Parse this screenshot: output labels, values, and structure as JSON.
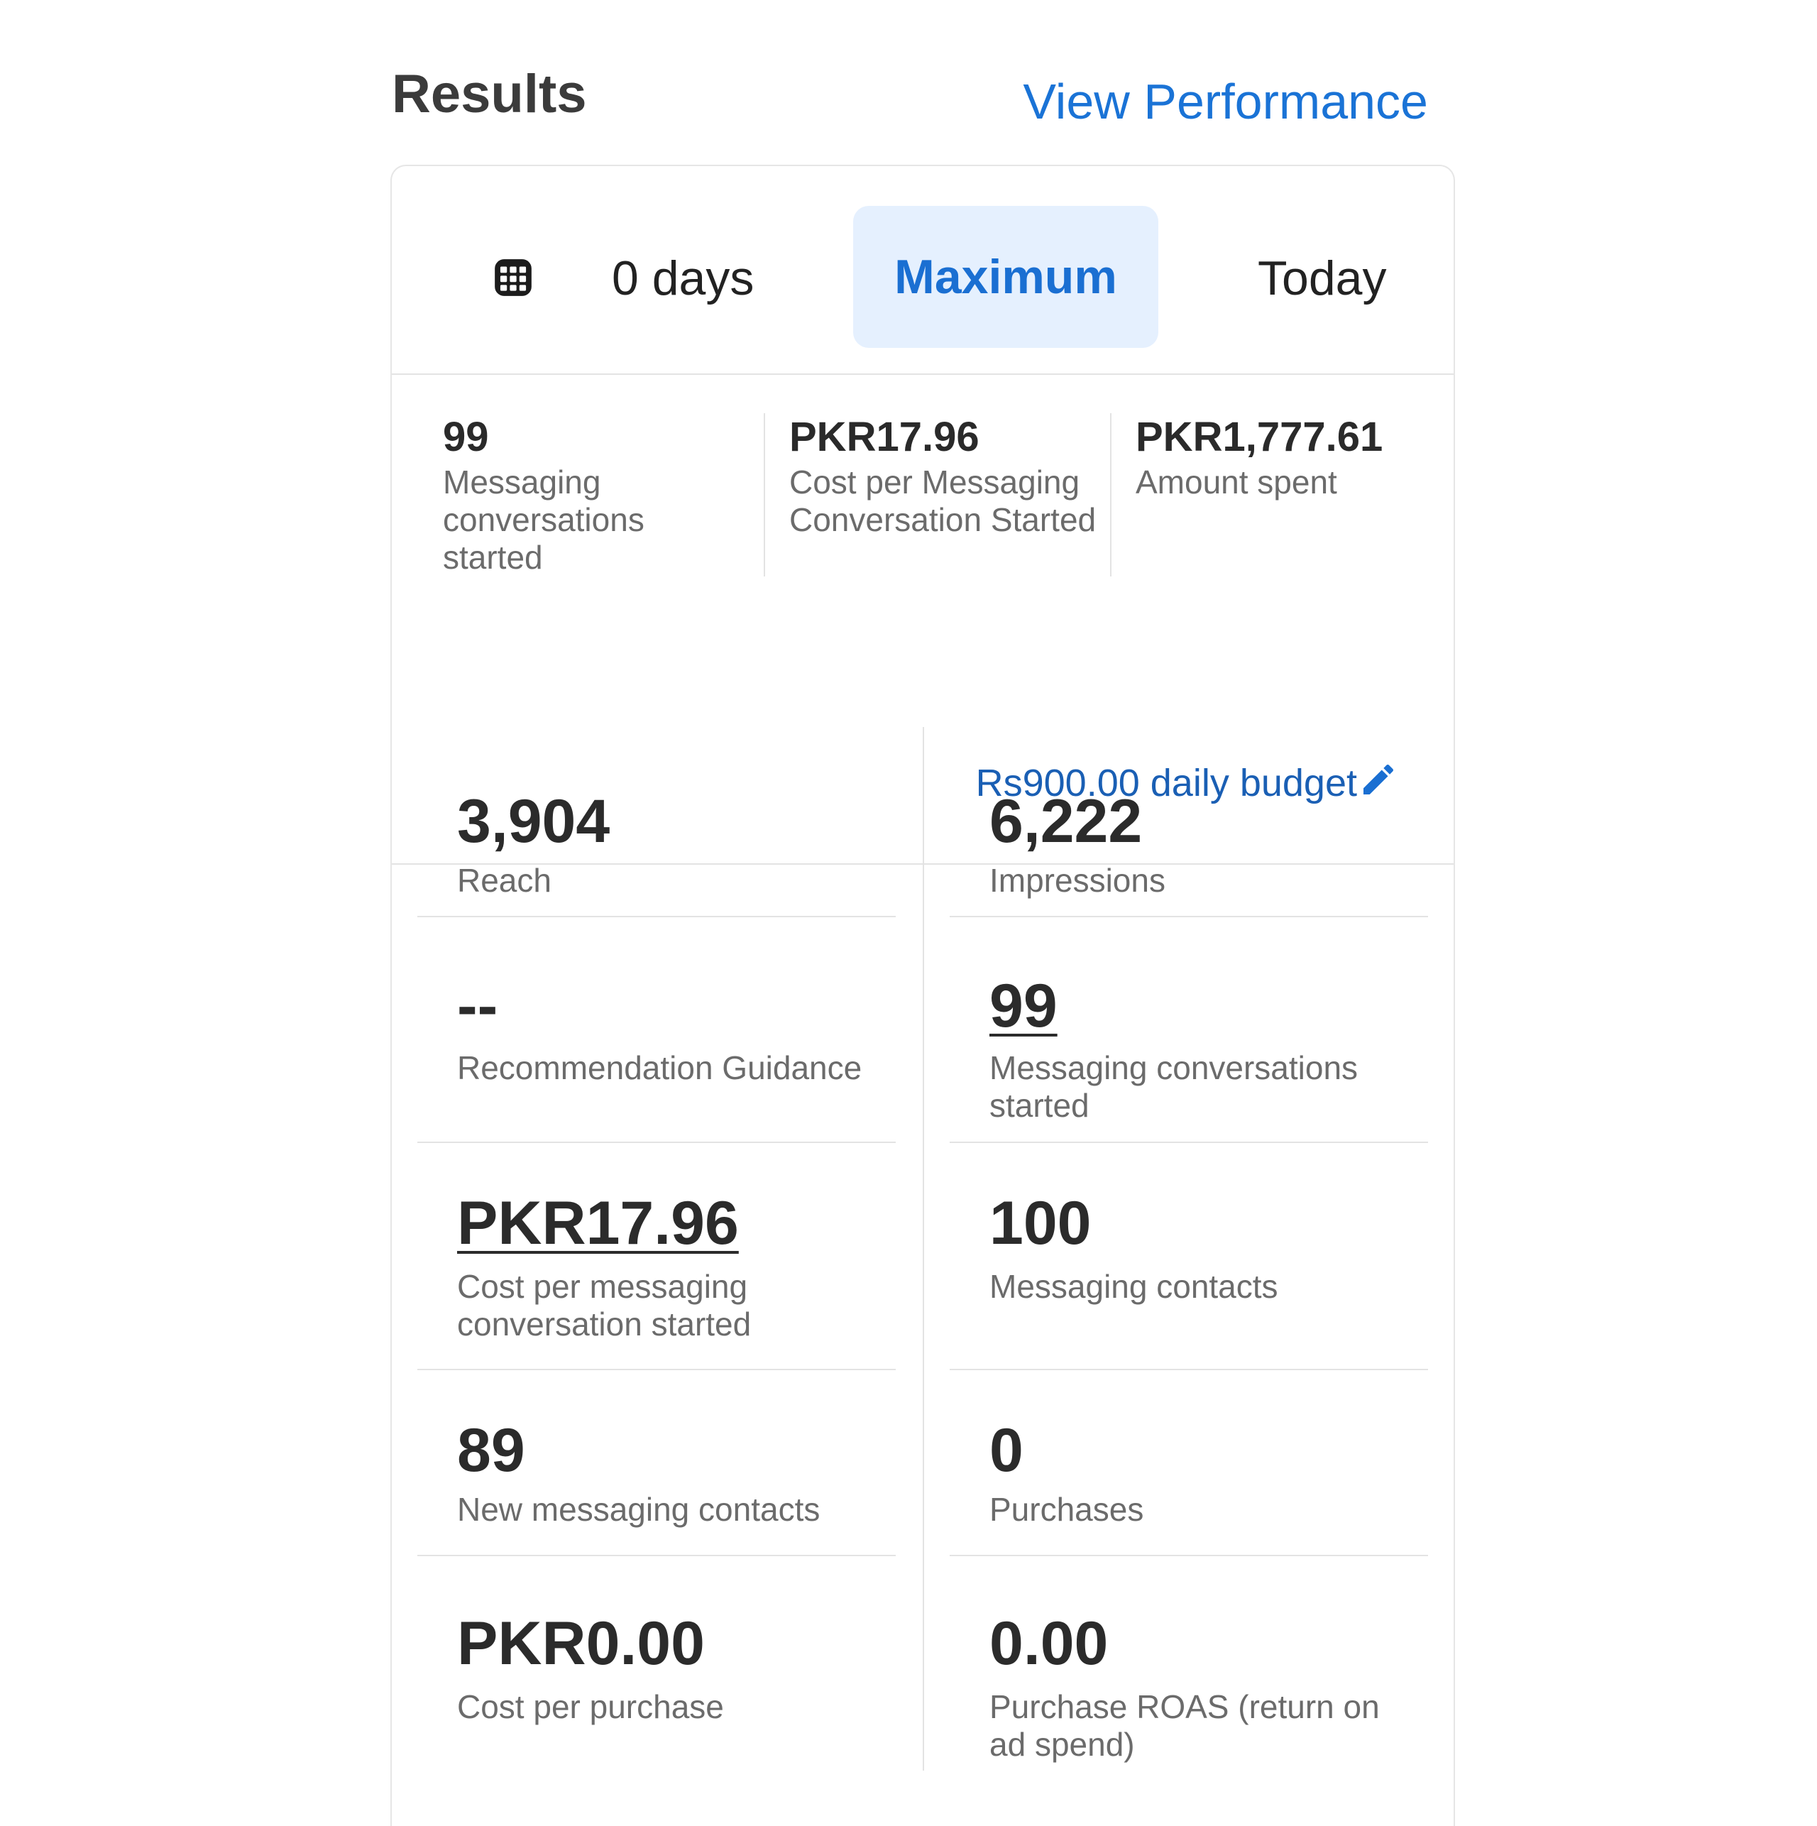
{
  "header": {
    "title": "Results",
    "view_performance": "View Performance"
  },
  "tabs": {
    "days": "0 days",
    "maximum": "Maximum",
    "today": "Today",
    "active": "Maximum"
  },
  "summary": {
    "items": [
      {
        "value": "99",
        "label": "Messaging conversations started"
      },
      {
        "value": "PKR17.96",
        "label": "Cost per Messaging Conversation Started"
      },
      {
        "value": "PKR1,777.61",
        "label": "Amount spent"
      }
    ],
    "budget": "Rs900.00 daily budget"
  },
  "metrics": [
    {
      "value": "3,904",
      "label": "Reach"
    },
    {
      "value": "6,222",
      "label": "Impressions"
    },
    {
      "value": "--",
      "label": "Recommendation Guidance"
    },
    {
      "value": "99",
      "label": "Messaging conversations started"
    },
    {
      "value": "PKR17.96",
      "label": "Cost per messaging conversation started"
    },
    {
      "value": "100",
      "label": "Messaging contacts"
    },
    {
      "value": "89",
      "label": "New messaging contacts"
    },
    {
      "value": "0",
      "label": "Purchases"
    },
    {
      "value": "PKR0.00",
      "label": "Cost per purchase"
    },
    {
      "value": "0.00",
      "label": "Purchase ROAS (return on ad spend)"
    }
  ],
  "colors": {
    "accent_blue": "#1a73d6",
    "tab_active_bg": "#e5f0fe",
    "divider": "#e3e3e3"
  }
}
